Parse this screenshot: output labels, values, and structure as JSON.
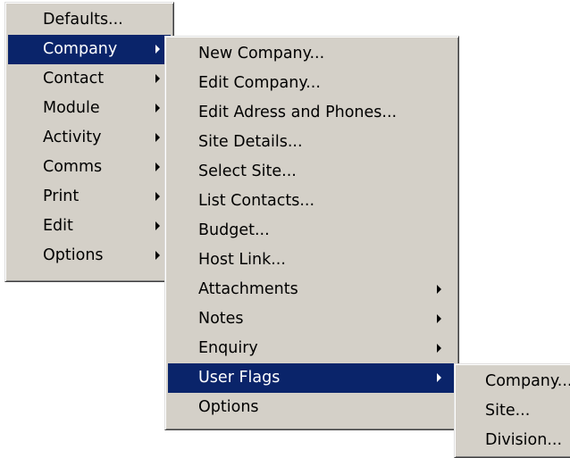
{
  "main_menu": {
    "items": [
      {
        "label": "Defaults...",
        "has_submenu": false,
        "selected": false
      },
      {
        "label": "Company",
        "has_submenu": true,
        "selected": true
      },
      {
        "label": "Contact",
        "has_submenu": true,
        "selected": false
      },
      {
        "label": "Module",
        "has_submenu": true,
        "selected": false
      },
      {
        "label": "Activity",
        "has_submenu": true,
        "selected": false
      },
      {
        "label": "Comms",
        "has_submenu": true,
        "selected": false
      },
      {
        "label": "Print",
        "has_submenu": true,
        "selected": false
      },
      {
        "label": "Edit",
        "has_submenu": true,
        "selected": false
      },
      {
        "label": "Options",
        "has_submenu": true,
        "selected": false
      }
    ]
  },
  "company_submenu": {
    "items": [
      {
        "label": "New Company...",
        "has_submenu": false,
        "selected": false
      },
      {
        "label": "Edit Company...",
        "has_submenu": false,
        "selected": false
      },
      {
        "label": "Edit Adress and Phones...",
        "has_submenu": false,
        "selected": false
      },
      {
        "label": "Site Details...",
        "has_submenu": false,
        "selected": false
      },
      {
        "label": "Select Site...",
        "has_submenu": false,
        "selected": false
      },
      {
        "label": "List Contacts...",
        "has_submenu": false,
        "selected": false
      },
      {
        "label": "Budget...",
        "has_submenu": false,
        "selected": false
      },
      {
        "label": "Host Link...",
        "has_submenu": false,
        "selected": false
      },
      {
        "label": "Attachments",
        "has_submenu": true,
        "selected": false
      },
      {
        "label": "Notes",
        "has_submenu": true,
        "selected": false
      },
      {
        "label": "Enquiry",
        "has_submenu": true,
        "selected": false
      },
      {
        "label": "User Flags",
        "has_submenu": true,
        "selected": true
      },
      {
        "label": "Options",
        "has_submenu": false,
        "selected": false
      }
    ]
  },
  "user_flags_submenu": {
    "items": [
      {
        "label": "Company...",
        "selected": false
      },
      {
        "label": "Site...",
        "selected": false
      },
      {
        "label": "Division...",
        "selected": false
      }
    ]
  },
  "colors": {
    "menu_background": "#d4d0c8",
    "highlight_background": "#0a246a",
    "highlight_text": "#ffffff"
  }
}
